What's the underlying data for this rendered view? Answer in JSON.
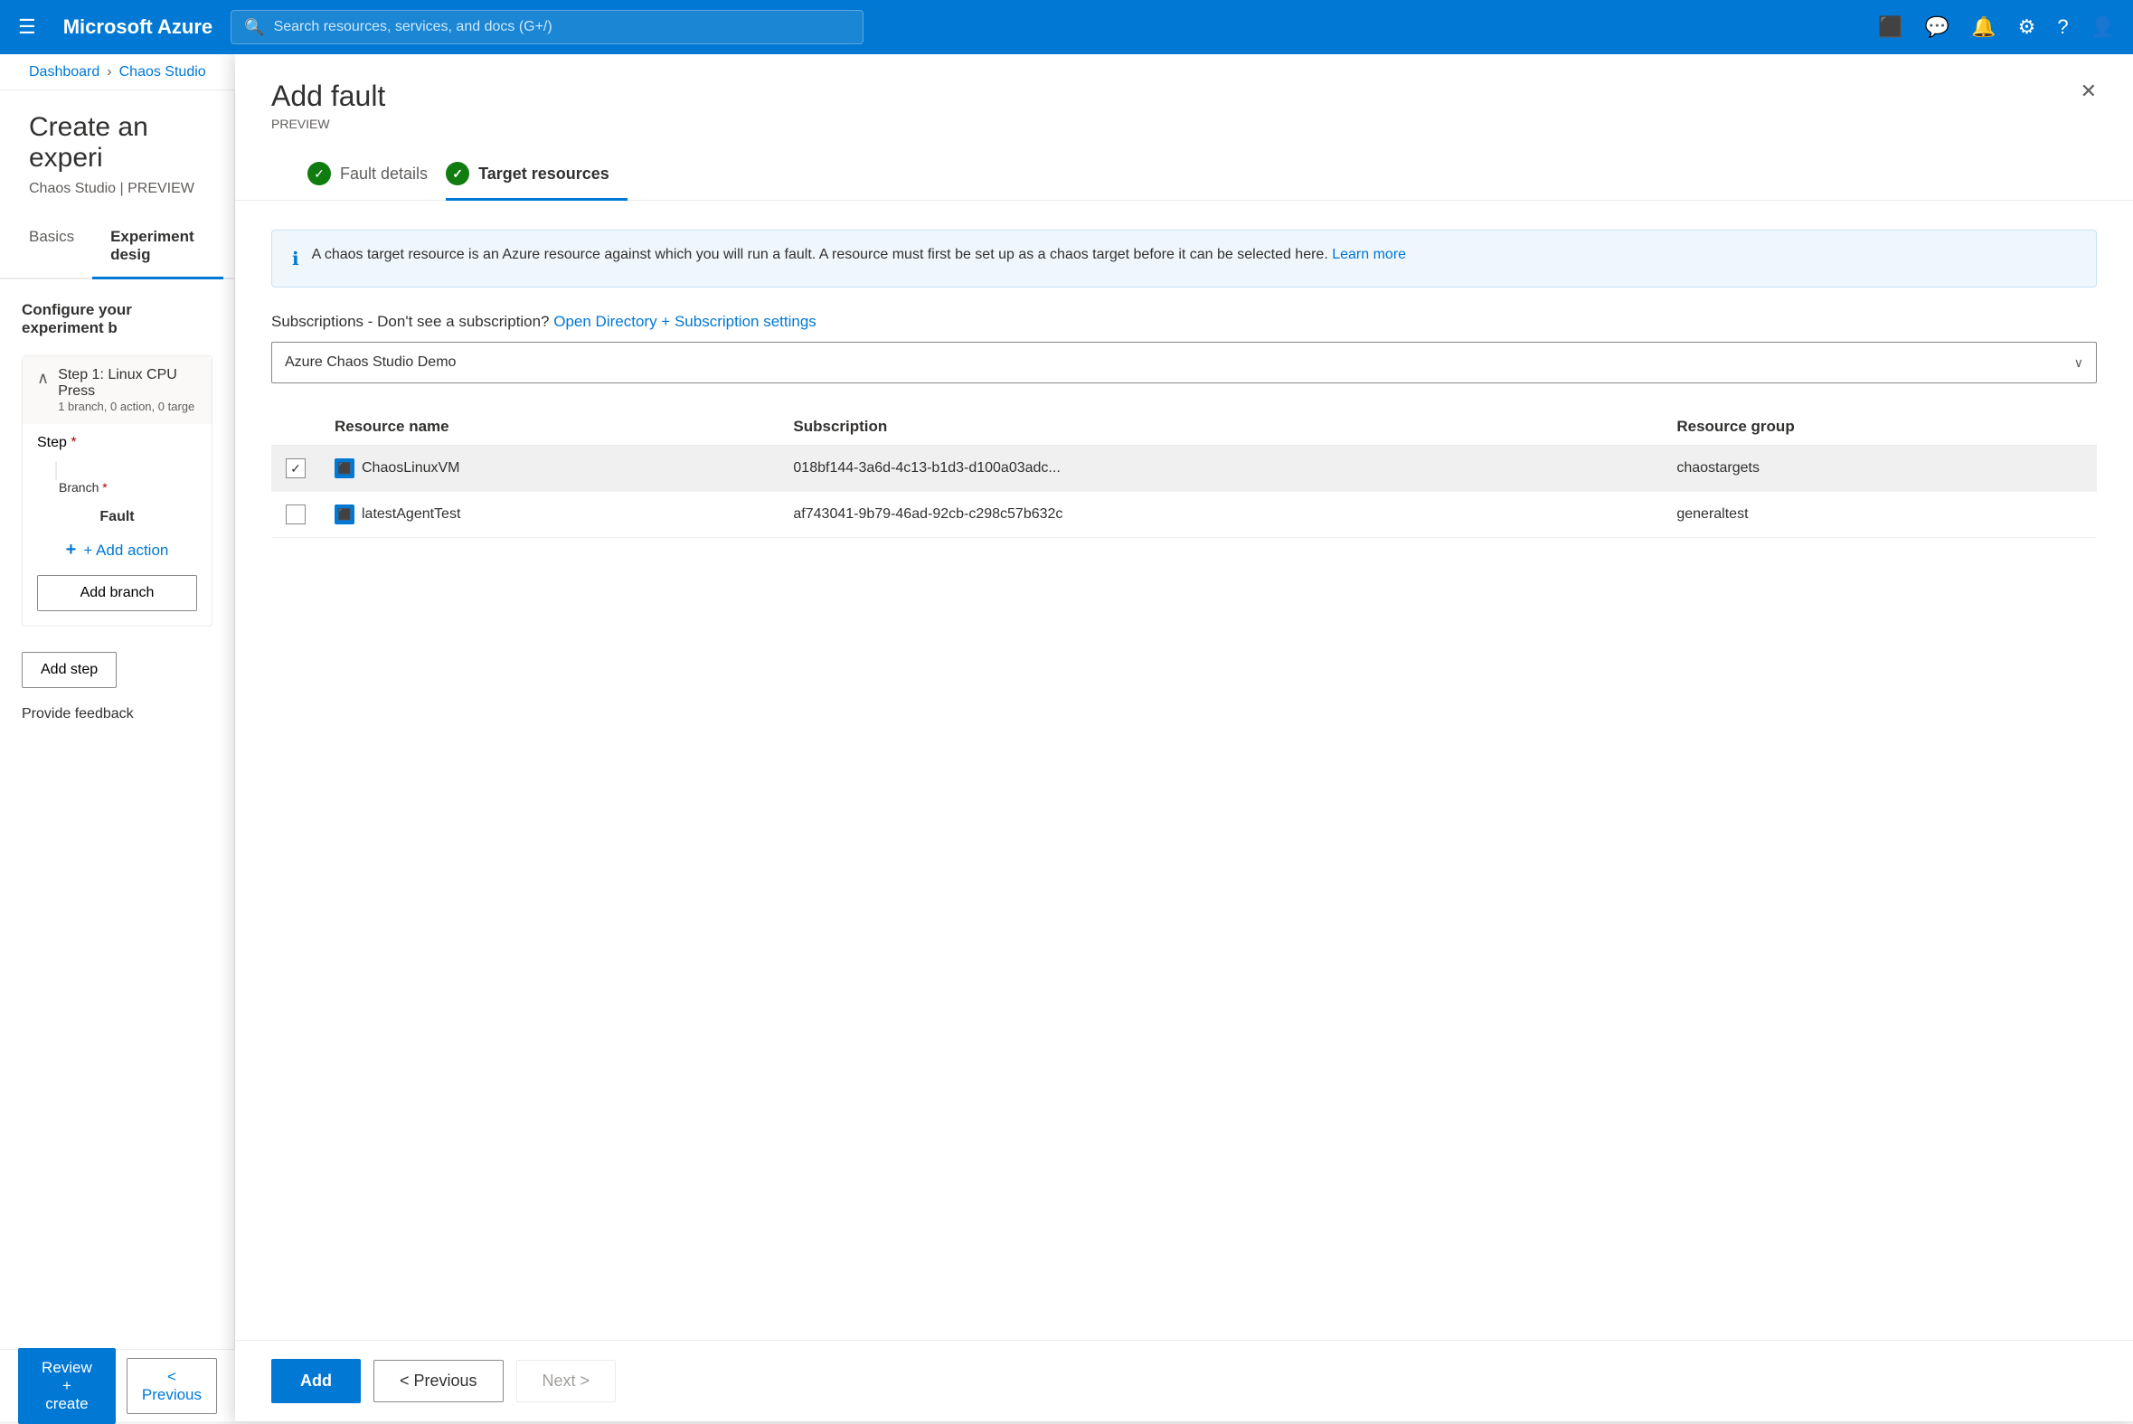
{
  "topnav": {
    "hamburger": "☰",
    "brand": "Microsoft Azure",
    "search_placeholder": "Search resources, services, and docs (G+/)"
  },
  "breadcrumb": {
    "dashboard": "Dashboard",
    "chaos_studio": "Chaos Studio",
    "separator": "›"
  },
  "left_panel": {
    "title": "Create an experi",
    "subtitle": "Chaos Studio | PREVIEW",
    "tabs": [
      {
        "label": "Basics"
      },
      {
        "label": "Experiment desig",
        "active": true
      }
    ],
    "configure_label": "Configure your experiment b",
    "step": {
      "title": "Step 1: Linux CPU Press",
      "subtitle": "1 branch, 0 action, 0 targe",
      "step_label": "Step",
      "step_required": "*",
      "branch_label": "Branch",
      "branch_required": "*",
      "fault_label": "Fault",
      "add_action": "+ Add action",
      "add_branch": "Add branch",
      "add_step": "Add step",
      "feedback": "Provide feedback"
    }
  },
  "bottom_bar": {
    "review_create": "Review + create",
    "previous": "< Previous"
  },
  "panel": {
    "title": "Add fault",
    "preview_label": "PREVIEW",
    "close_icon": "✕",
    "steps": [
      {
        "label": "Fault details",
        "completed": true
      },
      {
        "label": "Target resources",
        "active": true,
        "completed": true
      }
    ],
    "info_text": "A chaos target resource is an Azure resource against which you will run a fault. A resource must first be set up as a chaos target before it can be selected here.",
    "learn_more": "Learn more",
    "subscription_prefix": "Subscriptions - Don't see a subscription?",
    "open_directory": "Open Directory + Subscription settings",
    "dropdown_value": "Azure Chaos Studio Demo",
    "table": {
      "columns": [
        {
          "label": ""
        },
        {
          "label": "Resource name"
        },
        {
          "label": "Subscription"
        },
        {
          "label": "Resource group"
        }
      ],
      "rows": [
        {
          "checked": true,
          "name": "ChaosLinuxVM",
          "subscription": "018bf144-3a6d-4c13-b1d3-d100a03adc...",
          "resource_group": "chaostargets",
          "highlighted": true
        },
        {
          "checked": false,
          "name": "latestAgentTest",
          "subscription": "af743041-9b79-46ad-92cb-c298c57b632c",
          "resource_group": "generaltest",
          "highlighted": false
        }
      ]
    },
    "footer": {
      "add": "Add",
      "previous": "< Previous",
      "next": "Next >"
    }
  }
}
